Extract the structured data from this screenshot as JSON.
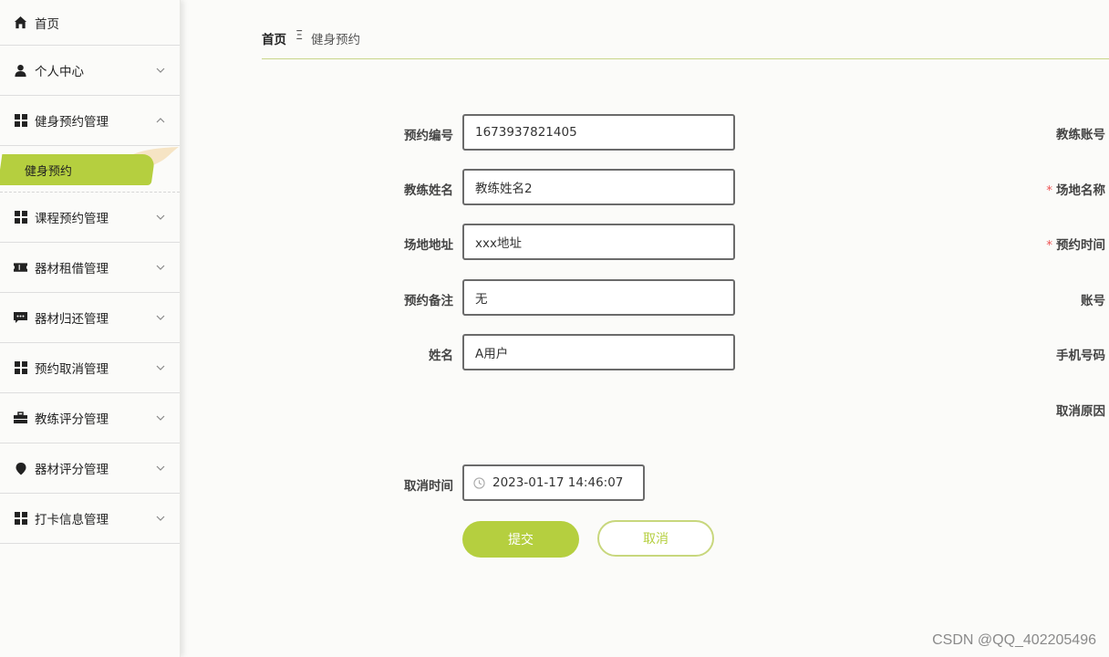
{
  "sidebar": {
    "items": [
      {
        "label": "首页",
        "icon": "home-icon"
      },
      {
        "label": "个人中心",
        "icon": "user-icon"
      },
      {
        "label": "健身预约管理",
        "icon": "grid-icon"
      },
      {
        "label": "课程预约管理",
        "icon": "grid-icon"
      },
      {
        "label": "器材租借管理",
        "icon": "ticket-icon"
      },
      {
        "label": "器材归还管理",
        "icon": "message-icon"
      },
      {
        "label": "预约取消管理",
        "icon": "grid-icon"
      },
      {
        "label": "教练评分管理",
        "icon": "briefcase-icon"
      },
      {
        "label": "器材评分管理",
        "icon": "location-icon"
      },
      {
        "label": "打卡信息管理",
        "icon": "grid-icon"
      }
    ],
    "active_sub": "健身预约"
  },
  "breadcrumb": {
    "home": "首页",
    "separator": "Ξ",
    "current": "健身预约"
  },
  "form": {
    "booking_no": {
      "label": "预约编号",
      "value": "1673937821405"
    },
    "coach_name": {
      "label": "教练姓名",
      "value": "教练姓名2"
    },
    "venue_address": {
      "label": "场地地址",
      "value": "xxx地址"
    },
    "booking_note": {
      "label": "预约备注",
      "value": "无"
    },
    "name": {
      "label": "姓名",
      "value": "A用户"
    },
    "cancel_time": {
      "label": "取消时间",
      "value": "2023-01-17 14:46:07"
    },
    "right_labels": {
      "coach_account": "教练账号",
      "venue_name": "场地名称",
      "booking_time": "预约时间",
      "account": "账号",
      "phone": "手机号码",
      "cancel_reason": "取消原因"
    },
    "required_mark": "*",
    "submit_label": "提交",
    "cancel_label": "取消"
  },
  "colors": {
    "accent": "#b5cf3f",
    "required": "#e55555"
  },
  "watermark": "CSDN @QQ_402205496"
}
